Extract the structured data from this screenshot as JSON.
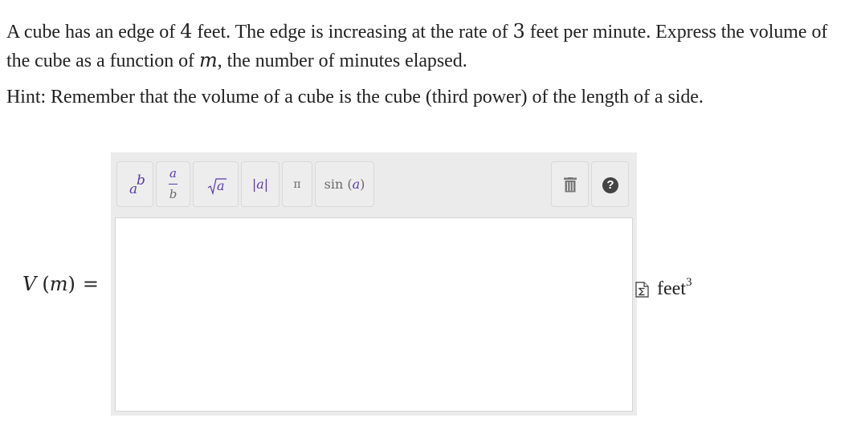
{
  "problem": {
    "text_before_edge": "A cube has an edge of ",
    "edge_value": "4",
    "text_after_edge": " feet. The edge is increasing at the rate of ",
    "rate_value": "3",
    "text_after_rate": " feet per minute. Express the volume of the cube as a function of ",
    "variable": "m",
    "text_after_variable": ", the number of minutes elapsed.",
    "hint": "Hint: Remember that the volume of a cube is the cube (third power) of the length of a side."
  },
  "answer": {
    "lhs_function": "V",
    "lhs_open": "(",
    "lhs_variable": "m",
    "lhs_close": ")",
    "equals": "=",
    "value": "",
    "units_text": "feet",
    "units_exponent": "3"
  },
  "toolbar": {
    "power_base": "a",
    "power_exp": "b",
    "frac_num": "a",
    "frac_den": "b",
    "sqrt_arg": "a",
    "abs_label": "|a|",
    "pi_label": "π",
    "sin_func": "sin",
    "sin_open": "(",
    "sin_arg": "a",
    "sin_close": ")",
    "help_label": "?"
  },
  "colors": {
    "accent_purple": "#5a3aa8",
    "editor_background": "#ebebeb",
    "help_button": "#444444"
  },
  "icons": [
    "trash-icon",
    "help-icon",
    "equation-editor-icon"
  ]
}
